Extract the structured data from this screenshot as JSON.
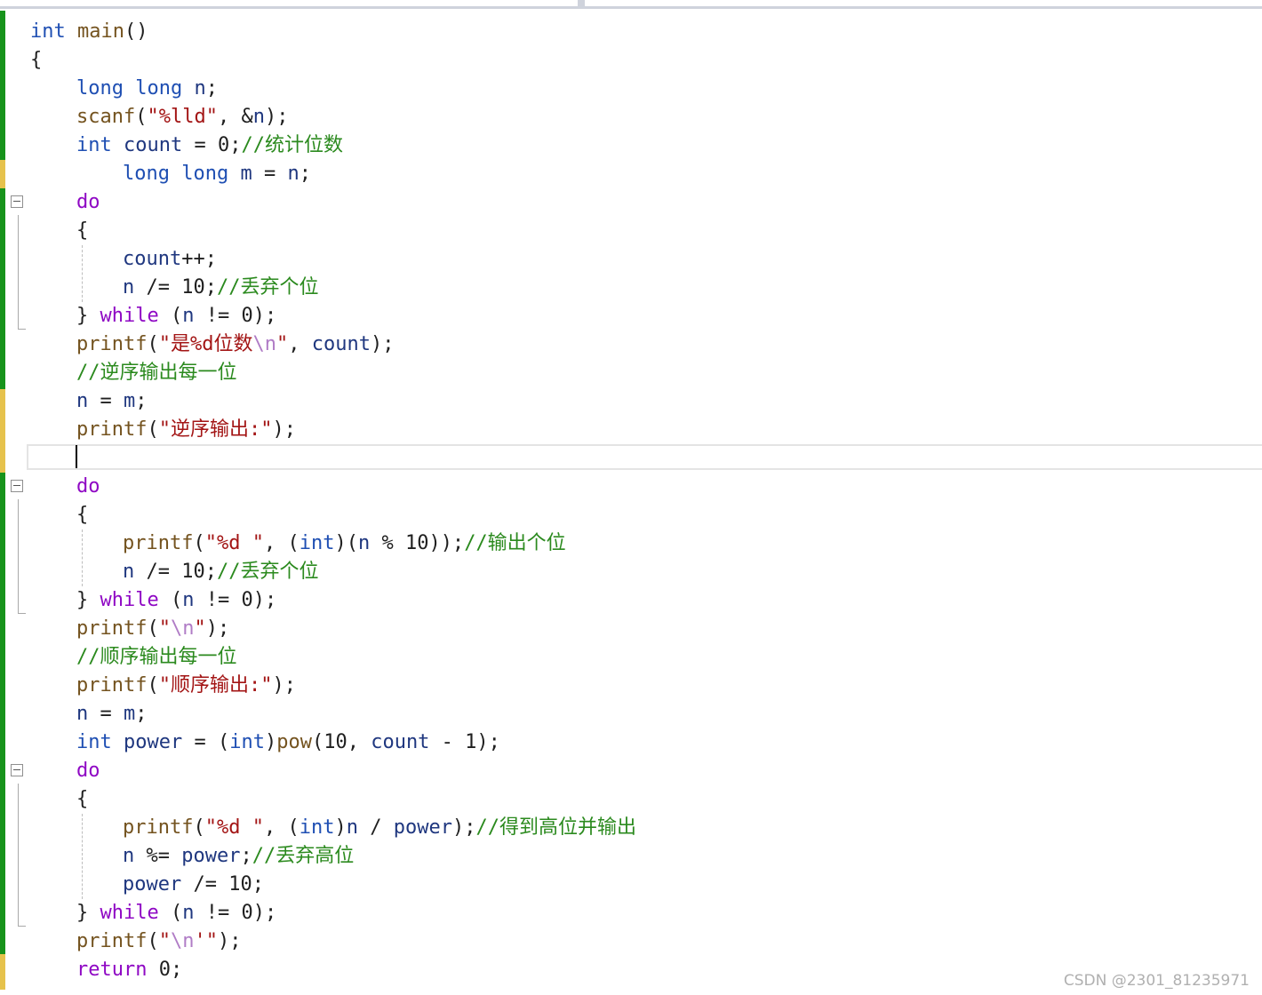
{
  "editor": {
    "language": "C",
    "colors": {
      "keyword": "#1f4fb3",
      "flow_keyword": "#8f08c4",
      "string": "#a31515",
      "escape": "#b07cc6",
      "comment": "#2b8a1e",
      "function": "#74531f",
      "local_variable": "#1f377f",
      "plain": "#1f1f1f",
      "change_bar_saved": "#17931b",
      "change_bar_unsaved": "#e6c24c",
      "watermark": "#b0b0b0"
    },
    "lines": [
      {
        "indent": 0,
        "tokens": [
          {
            "t": "int",
            "k": "keyword"
          },
          {
            "t": " ",
            "k": "plain"
          },
          {
            "t": "main",
            "k": "function"
          },
          {
            "t": "()",
            "k": "plain"
          }
        ]
      },
      {
        "indent": 0,
        "tokens": [
          {
            "t": "{",
            "k": "plain"
          }
        ]
      },
      {
        "indent": 1,
        "tokens": [
          {
            "t": "long",
            "k": "keyword"
          },
          {
            "t": " ",
            "k": "plain"
          },
          {
            "t": "long",
            "k": "keyword"
          },
          {
            "t": " ",
            "k": "plain"
          },
          {
            "t": "n",
            "k": "local_variable"
          },
          {
            "t": ";",
            "k": "plain"
          }
        ]
      },
      {
        "indent": 1,
        "tokens": [
          {
            "t": "scanf",
            "k": "function"
          },
          {
            "t": "(",
            "k": "plain"
          },
          {
            "t": "\"%lld\"",
            "k": "string"
          },
          {
            "t": ", &",
            "k": "plain"
          },
          {
            "t": "n",
            "k": "local_variable"
          },
          {
            "t": ");",
            "k": "plain"
          }
        ]
      },
      {
        "indent": 1,
        "tokens": [
          {
            "t": "int",
            "k": "keyword"
          },
          {
            "t": " ",
            "k": "plain"
          },
          {
            "t": "count",
            "k": "local_variable"
          },
          {
            "t": " = 0;",
            "k": "plain"
          },
          {
            "t": "//统计位数",
            "k": "comment"
          }
        ]
      },
      {
        "indent": 2,
        "tokens": [
          {
            "t": "long",
            "k": "keyword"
          },
          {
            "t": " ",
            "k": "plain"
          },
          {
            "t": "long",
            "k": "keyword"
          },
          {
            "t": " ",
            "k": "plain"
          },
          {
            "t": "m",
            "k": "local_variable"
          },
          {
            "t": " = ",
            "k": "plain"
          },
          {
            "t": "n",
            "k": "local_variable"
          },
          {
            "t": ";",
            "k": "plain"
          }
        ]
      },
      {
        "indent": 1,
        "tokens": [
          {
            "t": "do",
            "k": "flow_keyword"
          }
        ]
      },
      {
        "indent": 1,
        "tokens": [
          {
            "t": "{",
            "k": "plain"
          }
        ]
      },
      {
        "indent": 2,
        "tokens": [
          {
            "t": "count",
            "k": "local_variable"
          },
          {
            "t": "++;",
            "k": "plain"
          }
        ]
      },
      {
        "indent": 2,
        "tokens": [
          {
            "t": "n",
            "k": "local_variable"
          },
          {
            "t": " /= 10;",
            "k": "plain"
          },
          {
            "t": "//丢弃个位",
            "k": "comment"
          }
        ]
      },
      {
        "indent": 1,
        "tokens": [
          {
            "t": "} ",
            "k": "plain"
          },
          {
            "t": "while",
            "k": "flow_keyword"
          },
          {
            "t": " (",
            "k": "plain"
          },
          {
            "t": "n",
            "k": "local_variable"
          },
          {
            "t": " != 0);",
            "k": "plain"
          }
        ]
      },
      {
        "indent": 1,
        "tokens": [
          {
            "t": "printf",
            "k": "function"
          },
          {
            "t": "(",
            "k": "plain"
          },
          {
            "t": "\"是%d位数",
            "k": "string"
          },
          {
            "t": "\\n",
            "k": "escape"
          },
          {
            "t": "\"",
            "k": "string"
          },
          {
            "t": ", ",
            "k": "plain"
          },
          {
            "t": "count",
            "k": "local_variable"
          },
          {
            "t": ");",
            "k": "plain"
          }
        ]
      },
      {
        "indent": 1,
        "tokens": [
          {
            "t": "//逆序输出每一位",
            "k": "comment"
          }
        ]
      },
      {
        "indent": 1,
        "tokens": [
          {
            "t": "n",
            "k": "local_variable"
          },
          {
            "t": " = ",
            "k": "plain"
          },
          {
            "t": "m",
            "k": "local_variable"
          },
          {
            "t": ";",
            "k": "plain"
          }
        ]
      },
      {
        "indent": 1,
        "tokens": [
          {
            "t": "printf",
            "k": "function"
          },
          {
            "t": "(",
            "k": "plain"
          },
          {
            "t": "\"逆序输出:\"",
            "k": "string"
          },
          {
            "t": ");",
            "k": "plain"
          }
        ]
      },
      {
        "indent": 1,
        "tokens": []
      },
      {
        "indent": 1,
        "tokens": [
          {
            "t": "do",
            "k": "flow_keyword"
          }
        ]
      },
      {
        "indent": 1,
        "tokens": [
          {
            "t": "{",
            "k": "plain"
          }
        ]
      },
      {
        "indent": 2,
        "tokens": [
          {
            "t": "printf",
            "k": "function"
          },
          {
            "t": "(",
            "k": "plain"
          },
          {
            "t": "\"%d \"",
            "k": "string"
          },
          {
            "t": ", (",
            "k": "plain"
          },
          {
            "t": "int",
            "k": "keyword"
          },
          {
            "t": ")(",
            "k": "plain"
          },
          {
            "t": "n",
            "k": "local_variable"
          },
          {
            "t": " % 10));",
            "k": "plain"
          },
          {
            "t": "//输出个位",
            "k": "comment"
          }
        ]
      },
      {
        "indent": 2,
        "tokens": [
          {
            "t": "n",
            "k": "local_variable"
          },
          {
            "t": " /= 10;",
            "k": "plain"
          },
          {
            "t": "//丢弃个位",
            "k": "comment"
          }
        ]
      },
      {
        "indent": 1,
        "tokens": [
          {
            "t": "} ",
            "k": "plain"
          },
          {
            "t": "while",
            "k": "flow_keyword"
          },
          {
            "t": " (",
            "k": "plain"
          },
          {
            "t": "n",
            "k": "local_variable"
          },
          {
            "t": " != 0);",
            "k": "plain"
          }
        ]
      },
      {
        "indent": 1,
        "tokens": [
          {
            "t": "printf",
            "k": "function"
          },
          {
            "t": "(",
            "k": "plain"
          },
          {
            "t": "\"",
            "k": "string"
          },
          {
            "t": "\\n",
            "k": "escape"
          },
          {
            "t": "\"",
            "k": "string"
          },
          {
            "t": ");",
            "k": "plain"
          }
        ]
      },
      {
        "indent": 1,
        "tokens": [
          {
            "t": "//顺序输出每一位",
            "k": "comment"
          }
        ]
      },
      {
        "indent": 1,
        "tokens": [
          {
            "t": "printf",
            "k": "function"
          },
          {
            "t": "(",
            "k": "plain"
          },
          {
            "t": "\"顺序输出:\"",
            "k": "string"
          },
          {
            "t": ");",
            "k": "plain"
          }
        ]
      },
      {
        "indent": 1,
        "tokens": [
          {
            "t": "n",
            "k": "local_variable"
          },
          {
            "t": " = ",
            "k": "plain"
          },
          {
            "t": "m",
            "k": "local_variable"
          },
          {
            "t": ";",
            "k": "plain"
          }
        ]
      },
      {
        "indent": 1,
        "tokens": [
          {
            "t": "int",
            "k": "keyword"
          },
          {
            "t": " ",
            "k": "plain"
          },
          {
            "t": "power",
            "k": "local_variable"
          },
          {
            "t": " = (",
            "k": "plain"
          },
          {
            "t": "int",
            "k": "keyword"
          },
          {
            "t": ")",
            "k": "plain"
          },
          {
            "t": "pow",
            "k": "function"
          },
          {
            "t": "(10, ",
            "k": "plain"
          },
          {
            "t": "count",
            "k": "local_variable"
          },
          {
            "t": " - 1);",
            "k": "plain"
          }
        ]
      },
      {
        "indent": 1,
        "tokens": [
          {
            "t": "do",
            "k": "flow_keyword"
          }
        ]
      },
      {
        "indent": 1,
        "tokens": [
          {
            "t": "{",
            "k": "plain"
          }
        ]
      },
      {
        "indent": 2,
        "tokens": [
          {
            "t": "printf",
            "k": "function"
          },
          {
            "t": "(",
            "k": "plain"
          },
          {
            "t": "\"%d \"",
            "k": "string"
          },
          {
            "t": ", (",
            "k": "plain"
          },
          {
            "t": "int",
            "k": "keyword"
          },
          {
            "t": ")",
            "k": "plain"
          },
          {
            "t": "n",
            "k": "local_variable"
          },
          {
            "t": " / ",
            "k": "plain"
          },
          {
            "t": "power",
            "k": "local_variable"
          },
          {
            "t": ");",
            "k": "plain"
          },
          {
            "t": "//得到高位并输出",
            "k": "comment"
          }
        ]
      },
      {
        "indent": 2,
        "tokens": [
          {
            "t": "n",
            "k": "local_variable"
          },
          {
            "t": " %= ",
            "k": "plain"
          },
          {
            "t": "power",
            "k": "local_variable"
          },
          {
            "t": ";",
            "k": "plain"
          },
          {
            "t": "//丢弃高位",
            "k": "comment"
          }
        ]
      },
      {
        "indent": 2,
        "tokens": [
          {
            "t": "power",
            "k": "local_variable"
          },
          {
            "t": " /= 10;",
            "k": "plain"
          }
        ]
      },
      {
        "indent": 1,
        "tokens": [
          {
            "t": "} ",
            "k": "plain"
          },
          {
            "t": "while",
            "k": "flow_keyword"
          },
          {
            "t": " (",
            "k": "plain"
          },
          {
            "t": "n",
            "k": "local_variable"
          },
          {
            "t": " != 0);",
            "k": "plain"
          }
        ]
      },
      {
        "indent": 1,
        "tokens": [
          {
            "t": "printf",
            "k": "function"
          },
          {
            "t": "(",
            "k": "plain"
          },
          {
            "t": "\"",
            "k": "string"
          },
          {
            "t": "\\n",
            "k": "escape"
          },
          {
            "t": "'\"",
            "k": "string"
          },
          {
            "t": ");",
            "k": "plain"
          }
        ]
      },
      {
        "indent": 1,
        "tokens": [
          {
            "t": "return",
            "k": "flow_keyword"
          },
          {
            "t": " 0;",
            "k": "plain"
          }
        ]
      }
    ]
  },
  "watermark": "CSDN @2301_81235971"
}
